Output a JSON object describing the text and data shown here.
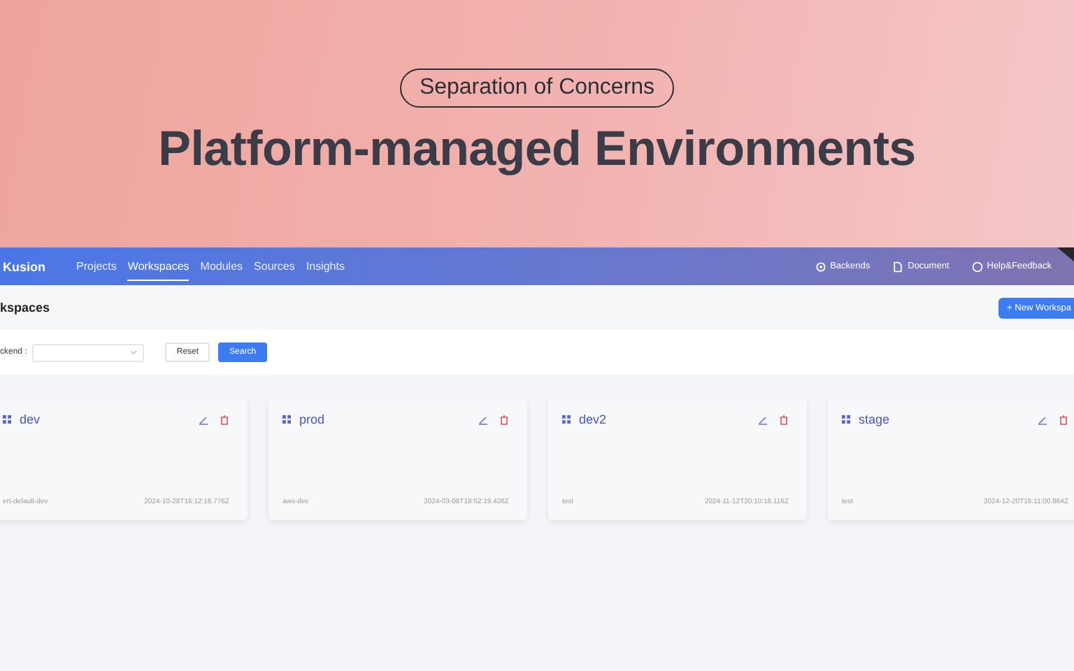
{
  "banner": {
    "tag": "Separation of Concerns",
    "title": "Platform-managed Environments"
  },
  "navbar": {
    "logo": "Kusion",
    "tabs": [
      {
        "label": "Projects",
        "selected": false
      },
      {
        "label": "Workspaces",
        "selected": true
      },
      {
        "label": "Modules",
        "selected": false
      },
      {
        "label": "Sources",
        "selected": false
      },
      {
        "label": "Insights",
        "selected": false
      }
    ],
    "links": [
      {
        "kind": "gear",
        "label": "Backends"
      },
      {
        "kind": "doc",
        "label": "Document"
      },
      {
        "kind": "help",
        "label": "Help&Feedback"
      }
    ]
  },
  "page": {
    "title": "kspaces",
    "new_button": "+ New Workspa"
  },
  "filter": {
    "label": "ckend :",
    "reset": "Reset",
    "search": "Search"
  },
  "cards": [
    {
      "name": "dev",
      "backend": "ert-default-dev",
      "time": "2024-10-28T16:12:16.776Z"
    },
    {
      "name": "prod",
      "backend": "aws-dev",
      "time": "2024-03-08T18:52:19.426Z"
    },
    {
      "name": "dev2",
      "backend": "test",
      "time": "2024-11-12T20:10:16.116Z"
    },
    {
      "name": "stage",
      "backend": "test",
      "time": "2024-12-20T16:11:00.864Z"
    }
  ]
}
